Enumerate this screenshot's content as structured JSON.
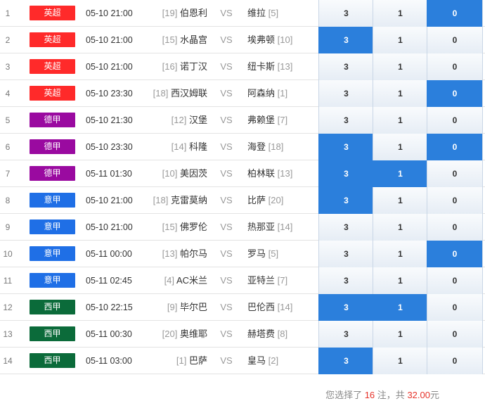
{
  "colors": {
    "epl": "#ff2a2a",
    "bundesliga": "#9a0aa0",
    "seriea": "#1f6fe6",
    "laliga": "#0b6b3a",
    "selected": "#2b7fdc",
    "highlight": "#e6332a"
  },
  "rows": [
    {
      "num": "1",
      "league": "英超",
      "lc": "epl",
      "time": "05-10 21:00",
      "home_rank": "[19]",
      "home": "伯恩利",
      "vs": "VS",
      "away": "维拉",
      "away_rank": "[5]",
      "o3": "3",
      "o1": "1",
      "o0": "0",
      "sel": [
        false,
        false,
        true
      ]
    },
    {
      "num": "2",
      "league": "英超",
      "lc": "epl",
      "time": "05-10 21:00",
      "home_rank": "[15]",
      "home": "水晶宫",
      "vs": "VS",
      "away": "埃弗顿",
      "away_rank": "[10]",
      "o3": "3",
      "o1": "1",
      "o0": "0",
      "sel": [
        true,
        false,
        false
      ]
    },
    {
      "num": "3",
      "league": "英超",
      "lc": "epl",
      "time": "05-10 21:00",
      "home_rank": "[16]",
      "home": "诺丁汉",
      "vs": "VS",
      "away": "纽卡斯",
      "away_rank": "[13]",
      "o3": "3",
      "o1": "1",
      "o0": "0",
      "sel": [
        false,
        false,
        false
      ]
    },
    {
      "num": "4",
      "league": "英超",
      "lc": "epl",
      "time": "05-10 23:30",
      "home_rank": "[18]",
      "home": "西汉姆联",
      "vs": "VS",
      "away": "阿森纳",
      "away_rank": "[1]",
      "o3": "3",
      "o1": "1",
      "o0": "0",
      "sel": [
        false,
        false,
        true
      ]
    },
    {
      "num": "5",
      "league": "德甲",
      "lc": "bundesliga",
      "time": "05-10 21:30",
      "home_rank": "[12]",
      "home": "汉堡",
      "vs": "VS",
      "away": "弗赖堡",
      "away_rank": "[7]",
      "o3": "3",
      "o1": "1",
      "o0": "0",
      "sel": [
        false,
        false,
        false
      ]
    },
    {
      "num": "6",
      "league": "德甲",
      "lc": "bundesliga",
      "time": "05-10 23:30",
      "home_rank": "[14]",
      "home": "科隆",
      "vs": "VS",
      "away": "海登",
      "away_rank": "[18]",
      "o3": "3",
      "o1": "1",
      "o0": "0",
      "sel": [
        true,
        false,
        true
      ]
    },
    {
      "num": "7",
      "league": "德甲",
      "lc": "bundesliga",
      "time": "05-11 01:30",
      "home_rank": "[10]",
      "home": "美因茨",
      "vs": "VS",
      "away": "柏林联",
      "away_rank": "[13]",
      "o3": "3",
      "o1": "1",
      "o0": "0",
      "sel": [
        true,
        true,
        false
      ]
    },
    {
      "num": "8",
      "league": "意甲",
      "lc": "seriea",
      "time": "05-10 21:00",
      "home_rank": "[18]",
      "home": "克雷莫纳",
      "vs": "VS",
      "away": "比萨",
      "away_rank": "[20]",
      "o3": "3",
      "o1": "1",
      "o0": "0",
      "sel": [
        true,
        false,
        false
      ]
    },
    {
      "num": "9",
      "league": "意甲",
      "lc": "seriea",
      "time": "05-10 21:00",
      "home_rank": "[15]",
      "home": "佛罗伦",
      "vs": "VS",
      "away": "热那亚",
      "away_rank": "[14]",
      "o3": "3",
      "o1": "1",
      "o0": "0",
      "sel": [
        false,
        false,
        false
      ]
    },
    {
      "num": "10",
      "league": "意甲",
      "lc": "seriea",
      "time": "05-11 00:00",
      "home_rank": "[13]",
      "home": "帕尔马",
      "vs": "VS",
      "away": "罗马",
      "away_rank": "[5]",
      "o3": "3",
      "o1": "1",
      "o0": "0",
      "sel": [
        false,
        false,
        true
      ]
    },
    {
      "num": "11",
      "league": "意甲",
      "lc": "seriea",
      "time": "05-11 02:45",
      "home_rank": "[4]",
      "home": "AC米兰",
      "vs": "VS",
      "away": "亚特兰",
      "away_rank": "[7]",
      "o3": "3",
      "o1": "1",
      "o0": "0",
      "sel": [
        false,
        false,
        false
      ]
    },
    {
      "num": "12",
      "league": "西甲",
      "lc": "laliga",
      "time": "05-10 22:15",
      "home_rank": "[9]",
      "home": "毕尔巴",
      "vs": "VS",
      "away": "巴伦西",
      "away_rank": "[14]",
      "o3": "3",
      "o1": "1",
      "o0": "0",
      "sel": [
        true,
        true,
        false
      ]
    },
    {
      "num": "13",
      "league": "西甲",
      "lc": "laliga",
      "time": "05-11 00:30",
      "home_rank": "[20]",
      "home": "奥维耶",
      "vs": "VS",
      "away": "赫塔费",
      "away_rank": "[8]",
      "o3": "3",
      "o1": "1",
      "o0": "0",
      "sel": [
        false,
        false,
        false
      ]
    },
    {
      "num": "14",
      "league": "西甲",
      "lc": "laliga",
      "time": "05-11 03:00",
      "home_rank": "[1]",
      "home": "巴萨",
      "vs": "VS",
      "away": "皇马",
      "away_rank": "[2]",
      "o3": "3",
      "o1": "1",
      "o0": "0",
      "sel": [
        true,
        false,
        false
      ]
    }
  ],
  "footer": {
    "prefix": "您选择了",
    "count": "16",
    "mid": "注，共",
    "amount": "32.00",
    "suffix": "元"
  }
}
